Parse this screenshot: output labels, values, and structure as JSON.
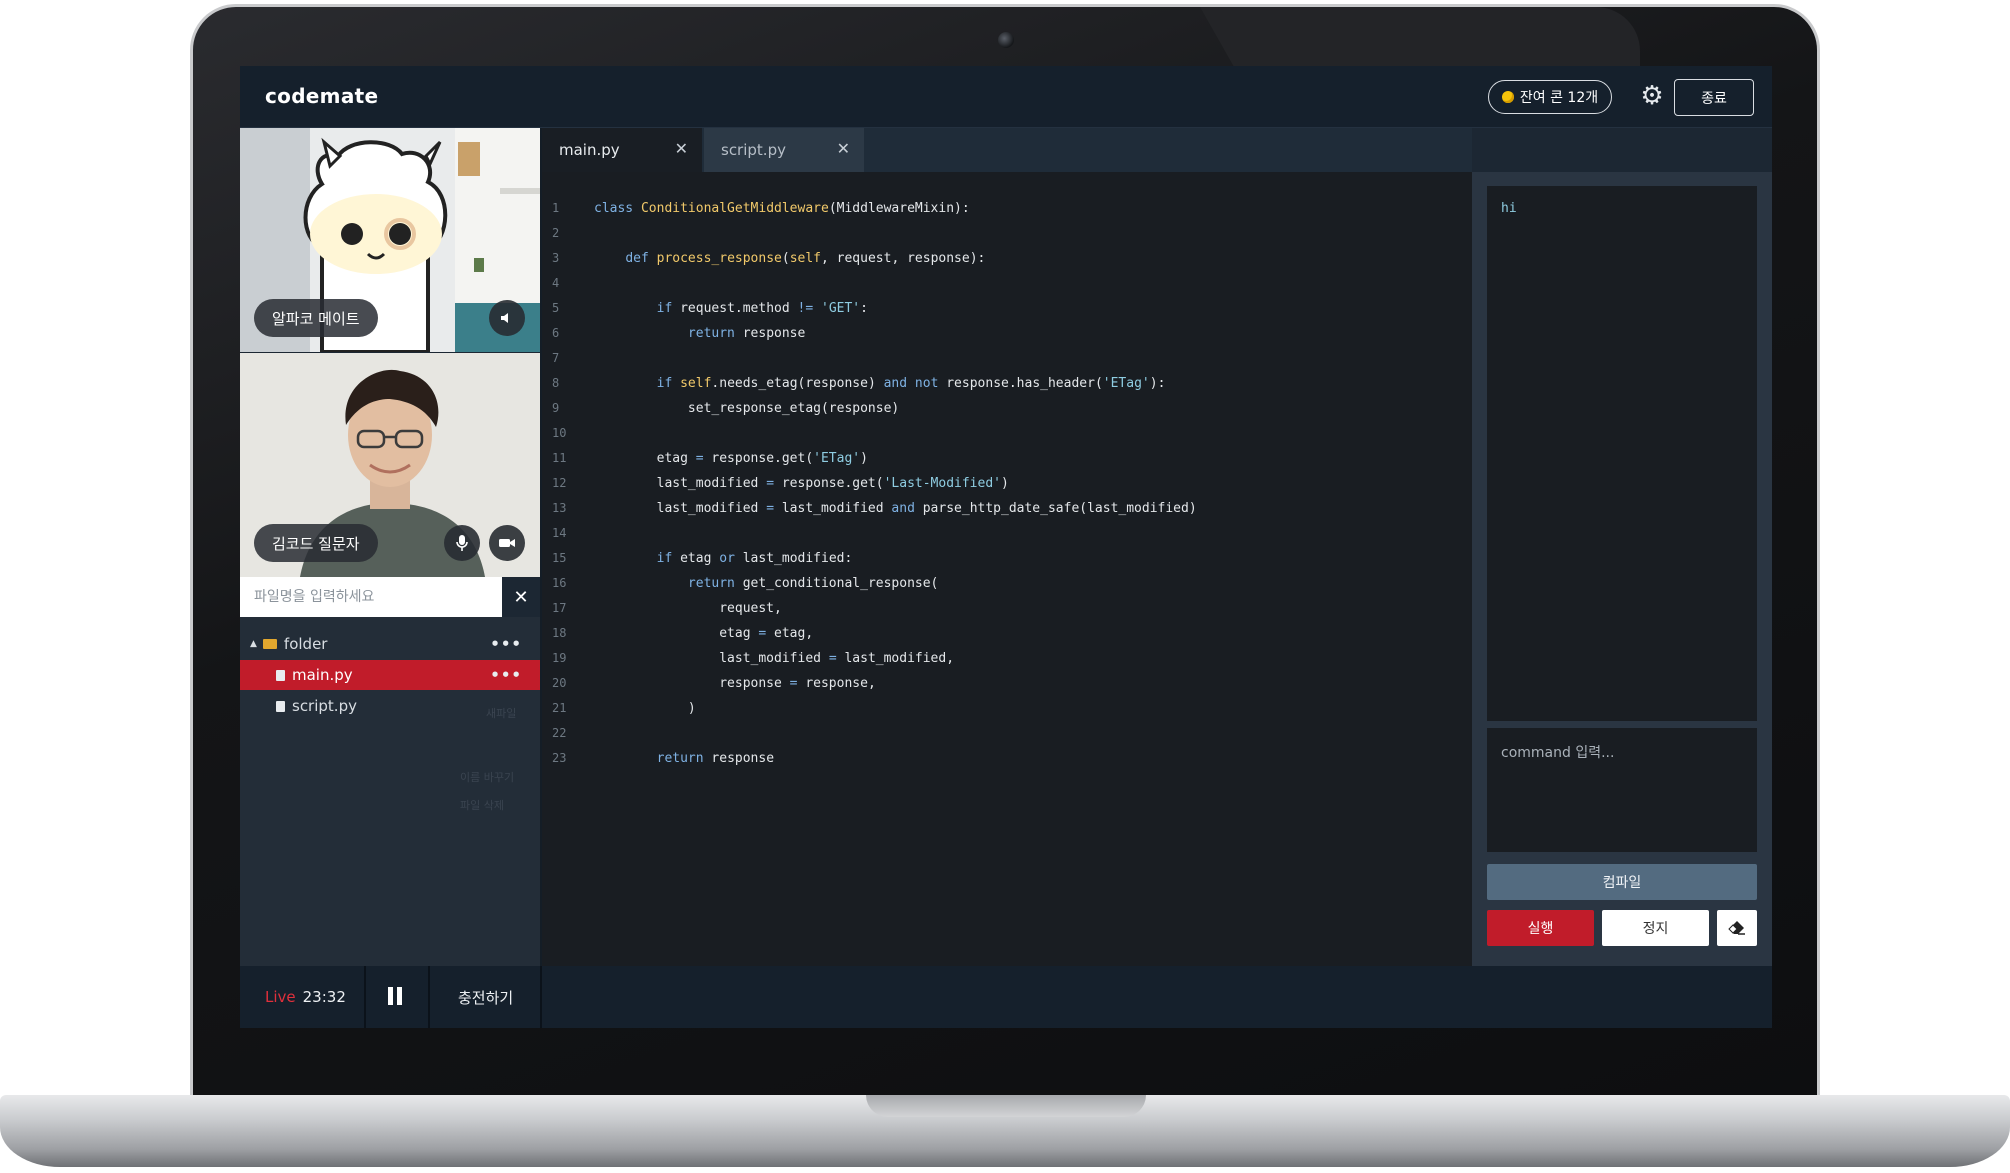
{
  "header": {
    "logo": "codemate",
    "coin_badge": "잔여 콘 12개",
    "settings_icon": "gear-icon",
    "exit_label": "종료"
  },
  "videos": [
    {
      "name": "알파코 메이트",
      "controls": [
        "speaker-icon"
      ]
    },
    {
      "name": "김코드 질문자",
      "controls": [
        "microphone-icon",
        "camera-icon"
      ]
    }
  ],
  "file_explorer": {
    "search_placeholder": "파일명을 입력하세요",
    "folder": "folder",
    "files": [
      "main.py",
      "script.py"
    ],
    "active_file": "main.py",
    "ghost_menu": [
      "새파일",
      "이름 바꾸기",
      "파일 삭제"
    ]
  },
  "editor": {
    "tabs": [
      {
        "label": "main.py",
        "active": true
      },
      {
        "label": "script.py",
        "active": false
      }
    ],
    "language": "python",
    "lines": [
      "class ConditionalGetMiddleware(MiddlewareMixin):",
      "",
      "    def process_response(self, request, response):",
      "",
      "        if request.method != 'GET':",
      "            return response",
      "",
      "        if self.needs_etag(response) and not response.has_header('ETag'):",
      "            set_response_etag(response)",
      "",
      "        etag = response.get('ETag')",
      "        last_modified = response.get('Last-Modified')",
      "        last_modified = last_modified and parse_http_date_safe(last_modified)",
      "",
      "        if etag or last_modified:",
      "            return get_conditional_response(",
      "                request,",
      "                etag = etag,",
      "                last_modified = last_modified,",
      "                response = response,",
      "            )",
      "",
      "        return response"
    ]
  },
  "console": {
    "output": "hi",
    "command_placeholder": "command 입력...",
    "compile_label": "컴파일",
    "run_label": "실행",
    "stop_label": "정지",
    "erase_icon": "eraser-icon"
  },
  "footer": {
    "live_label": "Live",
    "elapsed": "23:32",
    "pause_icon": "pause-icon",
    "charge_label": "충전하기"
  },
  "colors": {
    "accent_red": "#c11c2a",
    "coin_yellow": "#f5c30a",
    "topbar_bg": "#15202c",
    "editor_bg": "#191d22"
  }
}
